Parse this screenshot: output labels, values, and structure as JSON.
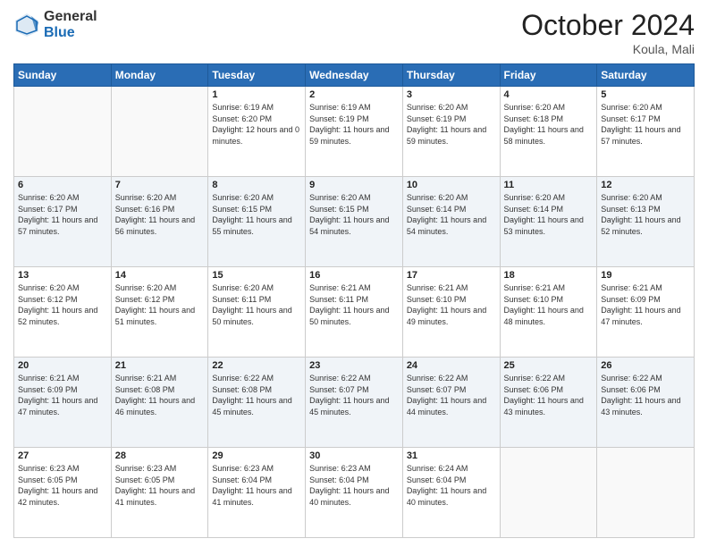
{
  "header": {
    "logo_general": "General",
    "logo_blue": "Blue",
    "month_title": "October 2024",
    "location": "Koula, Mali"
  },
  "days_of_week": [
    "Sunday",
    "Monday",
    "Tuesday",
    "Wednesday",
    "Thursday",
    "Friday",
    "Saturday"
  ],
  "weeks": [
    [
      {
        "day": "",
        "info": ""
      },
      {
        "day": "",
        "info": ""
      },
      {
        "day": "1",
        "info": "Sunrise: 6:19 AM\nSunset: 6:20 PM\nDaylight: 12 hours and 0 minutes."
      },
      {
        "day": "2",
        "info": "Sunrise: 6:19 AM\nSunset: 6:19 PM\nDaylight: 11 hours and 59 minutes."
      },
      {
        "day": "3",
        "info": "Sunrise: 6:20 AM\nSunset: 6:19 PM\nDaylight: 11 hours and 59 minutes."
      },
      {
        "day": "4",
        "info": "Sunrise: 6:20 AM\nSunset: 6:18 PM\nDaylight: 11 hours and 58 minutes."
      },
      {
        "day": "5",
        "info": "Sunrise: 6:20 AM\nSunset: 6:17 PM\nDaylight: 11 hours and 57 minutes."
      }
    ],
    [
      {
        "day": "6",
        "info": "Sunrise: 6:20 AM\nSunset: 6:17 PM\nDaylight: 11 hours and 57 minutes."
      },
      {
        "day": "7",
        "info": "Sunrise: 6:20 AM\nSunset: 6:16 PM\nDaylight: 11 hours and 56 minutes."
      },
      {
        "day": "8",
        "info": "Sunrise: 6:20 AM\nSunset: 6:15 PM\nDaylight: 11 hours and 55 minutes."
      },
      {
        "day": "9",
        "info": "Sunrise: 6:20 AM\nSunset: 6:15 PM\nDaylight: 11 hours and 54 minutes."
      },
      {
        "day": "10",
        "info": "Sunrise: 6:20 AM\nSunset: 6:14 PM\nDaylight: 11 hours and 54 minutes."
      },
      {
        "day": "11",
        "info": "Sunrise: 6:20 AM\nSunset: 6:14 PM\nDaylight: 11 hours and 53 minutes."
      },
      {
        "day": "12",
        "info": "Sunrise: 6:20 AM\nSunset: 6:13 PM\nDaylight: 11 hours and 52 minutes."
      }
    ],
    [
      {
        "day": "13",
        "info": "Sunrise: 6:20 AM\nSunset: 6:12 PM\nDaylight: 11 hours and 52 minutes."
      },
      {
        "day": "14",
        "info": "Sunrise: 6:20 AM\nSunset: 6:12 PM\nDaylight: 11 hours and 51 minutes."
      },
      {
        "day": "15",
        "info": "Sunrise: 6:20 AM\nSunset: 6:11 PM\nDaylight: 11 hours and 50 minutes."
      },
      {
        "day": "16",
        "info": "Sunrise: 6:21 AM\nSunset: 6:11 PM\nDaylight: 11 hours and 50 minutes."
      },
      {
        "day": "17",
        "info": "Sunrise: 6:21 AM\nSunset: 6:10 PM\nDaylight: 11 hours and 49 minutes."
      },
      {
        "day": "18",
        "info": "Sunrise: 6:21 AM\nSunset: 6:10 PM\nDaylight: 11 hours and 48 minutes."
      },
      {
        "day": "19",
        "info": "Sunrise: 6:21 AM\nSunset: 6:09 PM\nDaylight: 11 hours and 47 minutes."
      }
    ],
    [
      {
        "day": "20",
        "info": "Sunrise: 6:21 AM\nSunset: 6:09 PM\nDaylight: 11 hours and 47 minutes."
      },
      {
        "day": "21",
        "info": "Sunrise: 6:21 AM\nSunset: 6:08 PM\nDaylight: 11 hours and 46 minutes."
      },
      {
        "day": "22",
        "info": "Sunrise: 6:22 AM\nSunset: 6:08 PM\nDaylight: 11 hours and 45 minutes."
      },
      {
        "day": "23",
        "info": "Sunrise: 6:22 AM\nSunset: 6:07 PM\nDaylight: 11 hours and 45 minutes."
      },
      {
        "day": "24",
        "info": "Sunrise: 6:22 AM\nSunset: 6:07 PM\nDaylight: 11 hours and 44 minutes."
      },
      {
        "day": "25",
        "info": "Sunrise: 6:22 AM\nSunset: 6:06 PM\nDaylight: 11 hours and 43 minutes."
      },
      {
        "day": "26",
        "info": "Sunrise: 6:22 AM\nSunset: 6:06 PM\nDaylight: 11 hours and 43 minutes."
      }
    ],
    [
      {
        "day": "27",
        "info": "Sunrise: 6:23 AM\nSunset: 6:05 PM\nDaylight: 11 hours and 42 minutes."
      },
      {
        "day": "28",
        "info": "Sunrise: 6:23 AM\nSunset: 6:05 PM\nDaylight: 11 hours and 41 minutes."
      },
      {
        "day": "29",
        "info": "Sunrise: 6:23 AM\nSunset: 6:04 PM\nDaylight: 11 hours and 41 minutes."
      },
      {
        "day": "30",
        "info": "Sunrise: 6:23 AM\nSunset: 6:04 PM\nDaylight: 11 hours and 40 minutes."
      },
      {
        "day": "31",
        "info": "Sunrise: 6:24 AM\nSunset: 6:04 PM\nDaylight: 11 hours and 40 minutes."
      },
      {
        "day": "",
        "info": ""
      },
      {
        "day": "",
        "info": ""
      }
    ]
  ]
}
